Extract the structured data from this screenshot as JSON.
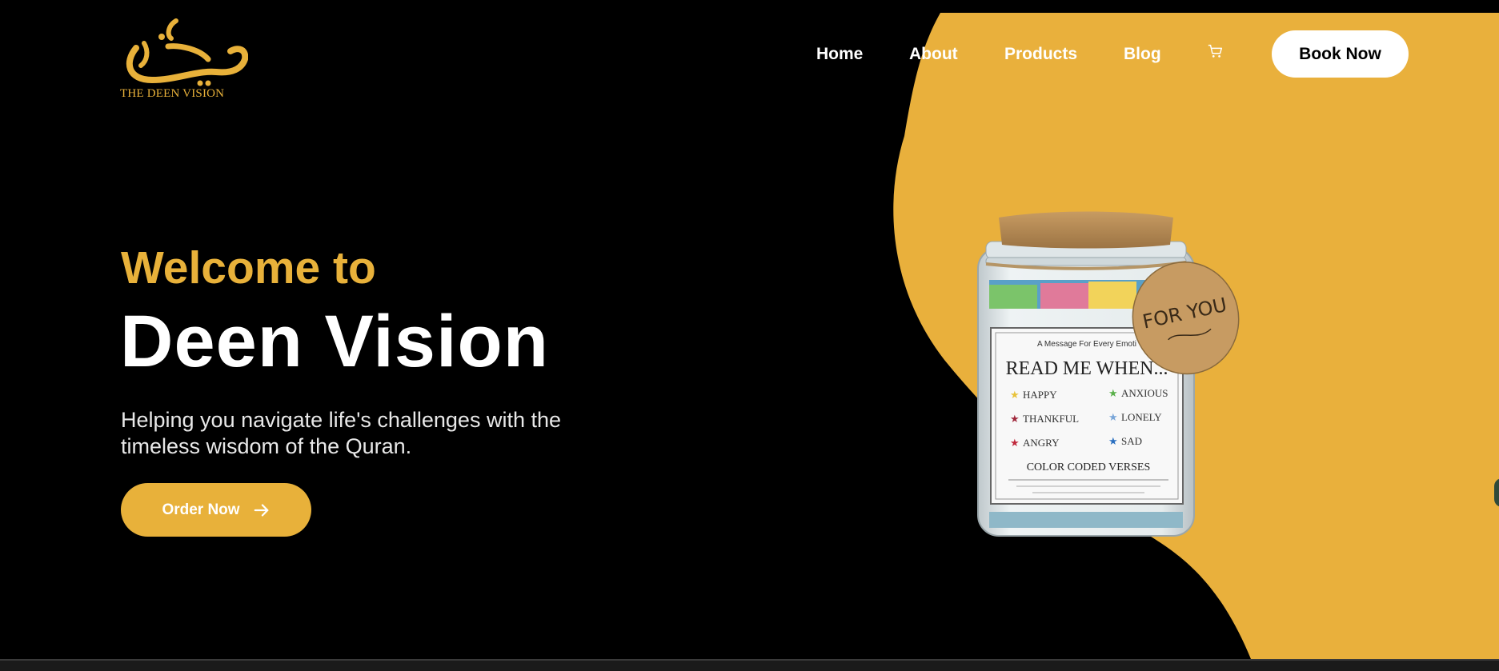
{
  "brand": {
    "logo_text": "THE DEEN VISION"
  },
  "nav": {
    "items": [
      {
        "label": "Home"
      },
      {
        "label": "About"
      },
      {
        "label": "Products"
      },
      {
        "label": "Blog"
      }
    ],
    "cart_icon": "shopping-cart-icon",
    "book_label": "Book Now"
  },
  "hero": {
    "welcome": "Welcome to",
    "title": "Deen Vision",
    "tagline": "Helping you navigate life's challenges with the timeless wisdom of the Quran.",
    "order_label": "Order Now",
    "order_icon": "arrow-right-icon"
  },
  "product_jar": {
    "tag": "FOR YOU",
    "subtitle": "A Message For Every Emoti",
    "heading": "READ ME WHEN...",
    "emotions": [
      "HAPPY",
      "ANXIOUS",
      "THANKFUL",
      "LONELY",
      "ANGRY",
      "SAD"
    ],
    "footer": "COLOR CODED VERSES"
  },
  "colors": {
    "accent": "#e8b13a",
    "background": "#000000",
    "text": "#ffffff"
  }
}
